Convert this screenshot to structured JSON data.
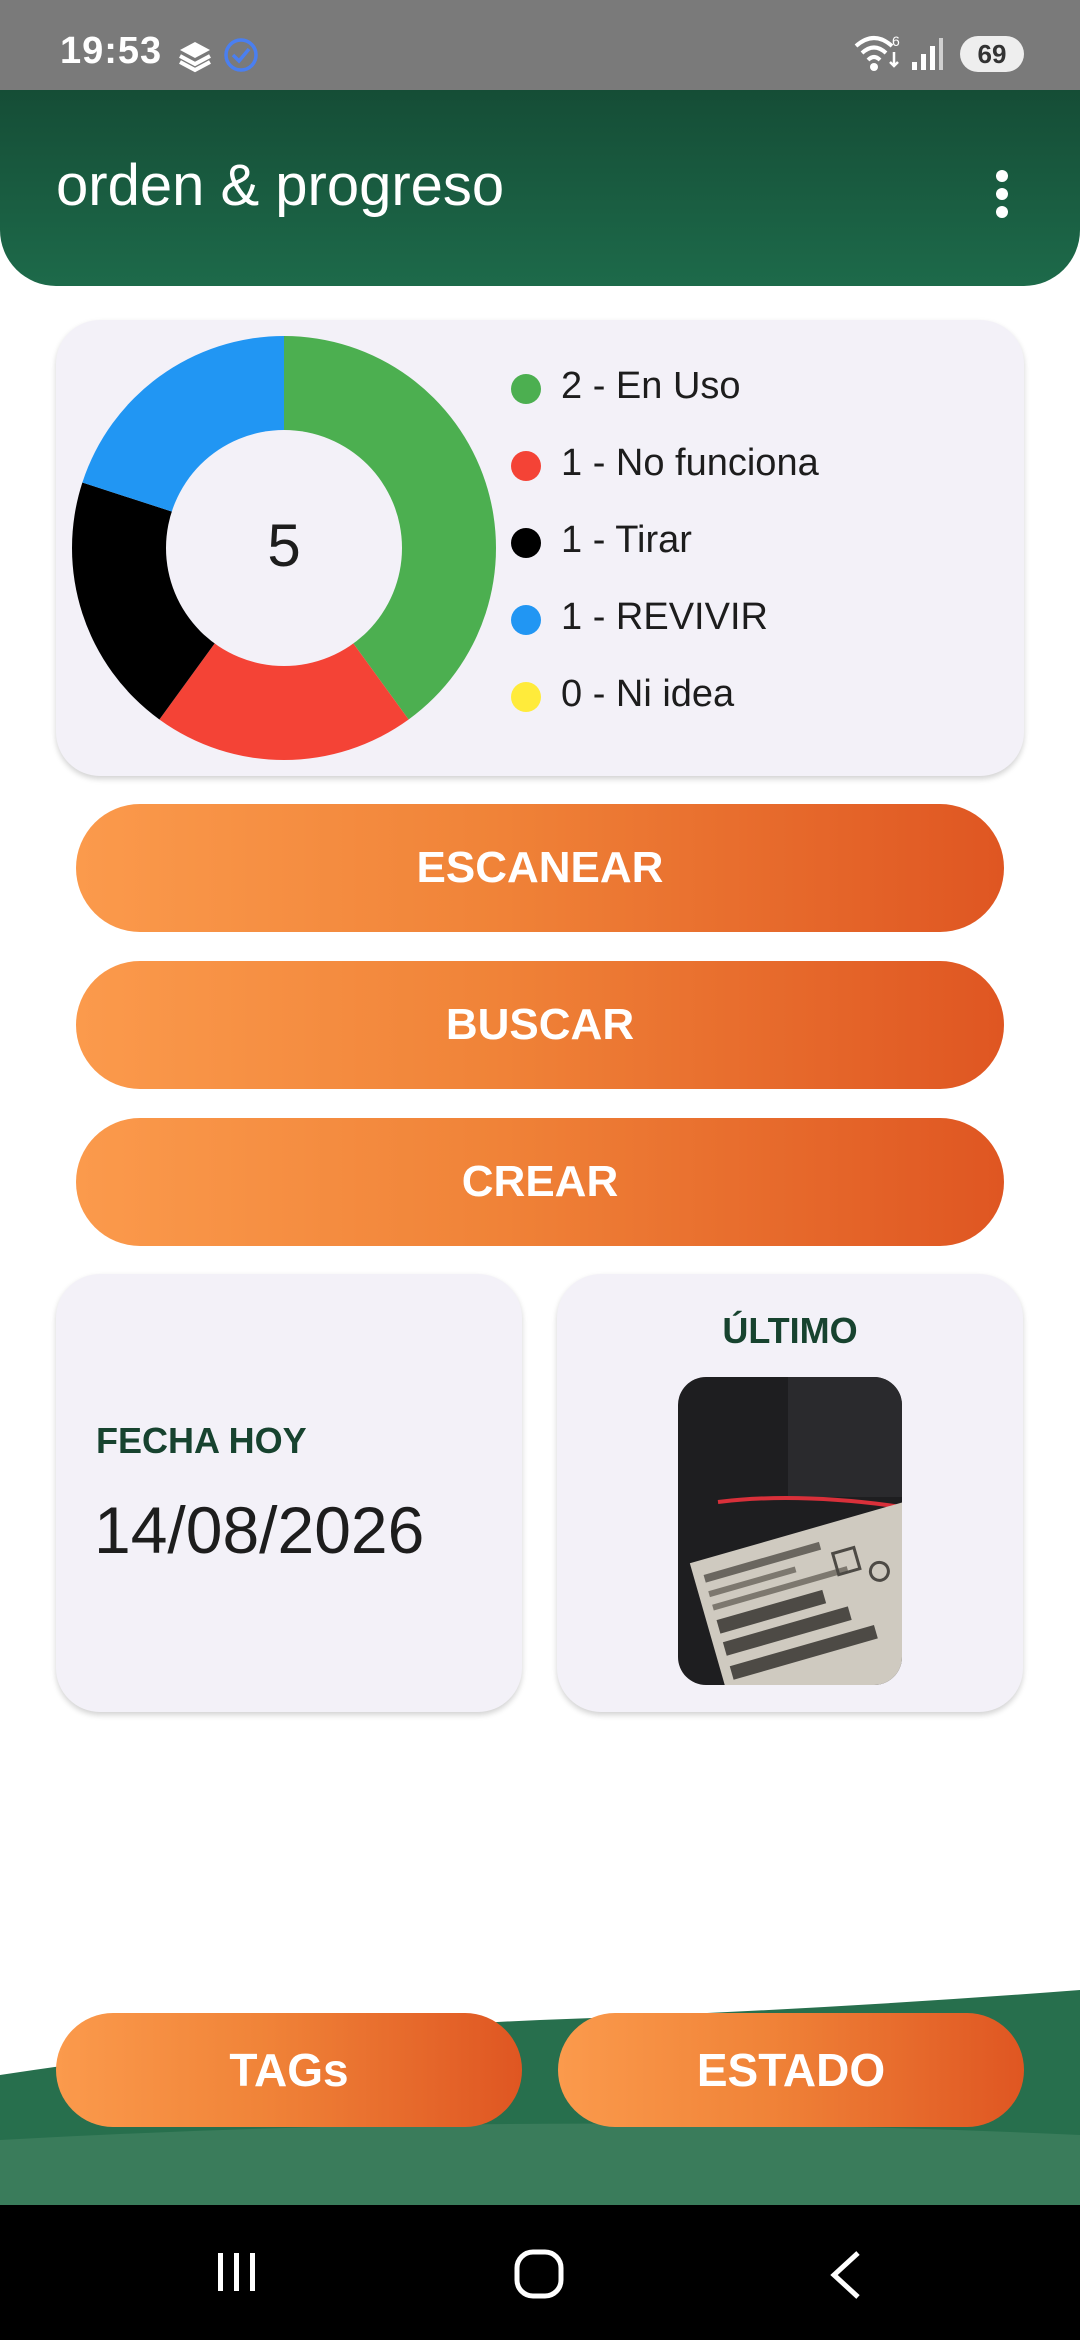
{
  "status_bar": {
    "time": "19:53",
    "battery": "69",
    "wifi_badge": "6"
  },
  "app_bar": {
    "title": "orden & progreso",
    "menu_icon": "more-vert-icon"
  },
  "chart_data": {
    "type": "pie",
    "center_label": "5",
    "slices": [
      {
        "label": "2 - En Uso",
        "value": 2,
        "color": "#4caf50"
      },
      {
        "label": "1 - No funciona",
        "value": 1,
        "color": "#f44336"
      },
      {
        "label": "1 - Tirar",
        "value": 1,
        "color": "#000000"
      },
      {
        "label": "1 - REVIVIR",
        "value": 1,
        "color": "#2196f3"
      },
      {
        "label": "0 - Ni idea",
        "value": 0,
        "color": "#ffeb3b"
      }
    ]
  },
  "actions": {
    "scan": "ESCANEAR",
    "search": "BUSCAR",
    "create": "CREAR"
  },
  "date_card": {
    "label": "FECHA HOY",
    "value": "14/08/2026"
  },
  "last_card": {
    "title": "ÚLTIMO"
  },
  "bottom": {
    "tags": "TAGs",
    "state": "ESTADO"
  },
  "colors": {
    "primary_green": "#1a5c40",
    "accent_orange": "#f08338"
  }
}
